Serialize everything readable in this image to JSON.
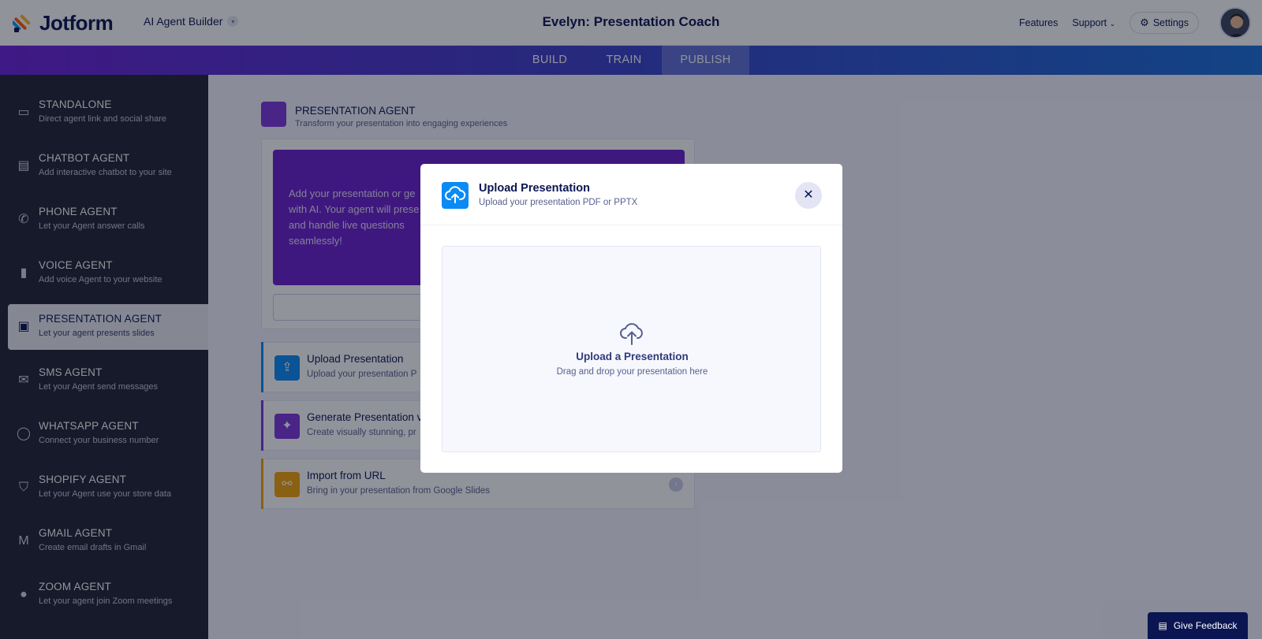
{
  "header": {
    "logo_text": "Jotform",
    "builder_label": "AI Agent Builder",
    "agent_title": "Evelyn: Presentation Coach",
    "links": {
      "features": "Features",
      "support": "Support",
      "settings": "Settings"
    }
  },
  "tabs": [
    {
      "label": "BUILD"
    },
    {
      "label": "TRAIN"
    },
    {
      "label": "PUBLISH",
      "active": true
    }
  ],
  "sidebar": {
    "items": [
      {
        "title": "STANDALONE",
        "subtitle": "Direct agent link and social share",
        "icon": "monitor-icon"
      },
      {
        "title": "CHATBOT AGENT",
        "subtitle": "Add interactive chatbot to your site",
        "icon": "chat-icon"
      },
      {
        "title": "PHONE AGENT",
        "subtitle": "Let your Agent answer calls",
        "icon": "phone-icon"
      },
      {
        "title": "VOICE AGENT",
        "subtitle": "Add voice Agent to your website",
        "icon": "voice-bars-icon"
      },
      {
        "title": "PRESENTATION AGENT",
        "subtitle": "Let your agent presents slides",
        "icon": "presentation-icon",
        "active": true
      },
      {
        "title": "SMS AGENT",
        "subtitle": "Let your Agent send messages",
        "icon": "sms-icon"
      },
      {
        "title": "WHATSAPP AGENT",
        "subtitle": "Connect your business number",
        "icon": "whatsapp-icon"
      },
      {
        "title": "SHOPIFY AGENT",
        "subtitle": "Let your Agent use your store data",
        "icon": "shopify-icon"
      },
      {
        "title": "GMAIL AGENT",
        "subtitle": "Create email drafts in Gmail",
        "icon": "gmail-icon"
      },
      {
        "title": "ZOOM AGENT",
        "subtitle": "Let your agent join Zoom meetings",
        "icon": "zoom-icon"
      }
    ]
  },
  "main": {
    "section_title": "PRESENTATION AGENT",
    "section_subtitle": "Transform your presentation into engaging experiences",
    "hero_text": "Add your presentation or ge with AI. Your agent will prese and handle live questions seamlessly!",
    "options": [
      {
        "title": "Upload Presentation",
        "subtitle": "Upload your presentation P",
        "color": "#0a8af5",
        "icon": "cloud-upload-icon"
      },
      {
        "title": "Generate Presentation v",
        "subtitle": "Create visually stunning, pr",
        "color": "#7a37dc",
        "icon": "sparkle-icon"
      },
      {
        "title": "Import from URL",
        "subtitle": "Bring in your presentation from Google Slides",
        "color": "#f2a20a",
        "icon": "link-icon"
      }
    ]
  },
  "modal": {
    "title": "Upload Presentation",
    "subtitle": "Upload your presentation PDF or PPTX",
    "dropzone_title": "Upload a Presentation",
    "dropzone_subtitle": "Drag and drop your presentation here"
  },
  "feedback": {
    "label": "Give Feedback"
  },
  "colors": {
    "accent_purple": "#6a1fce",
    "accent_blue": "#0a8af5",
    "navy": "#0a1551",
    "sidebar_bg": "#1f2433"
  }
}
